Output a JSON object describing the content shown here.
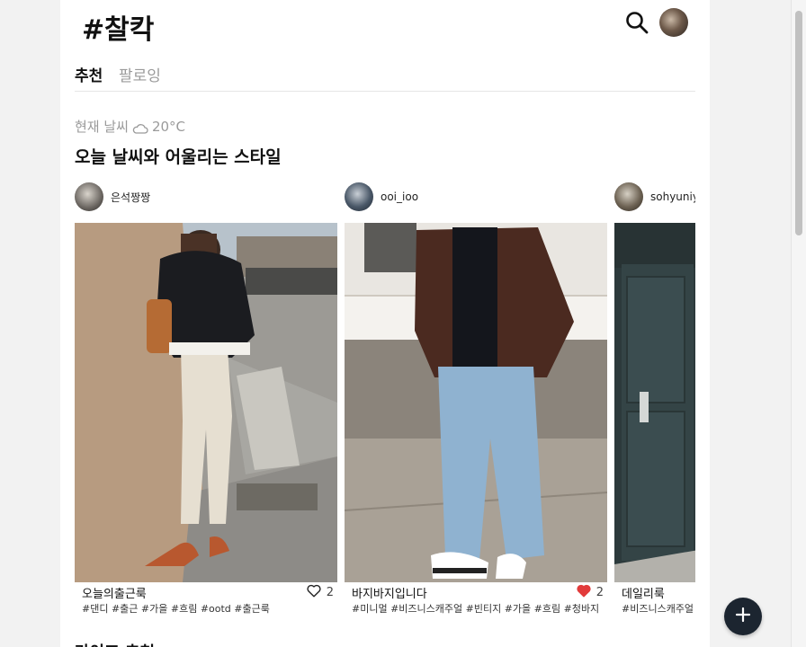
{
  "header": {
    "logo": "#찰칵",
    "search_icon": "search-icon",
    "avatar_icon": "profile-avatar"
  },
  "tabs": [
    {
      "label": "추천",
      "active": true
    },
    {
      "label": "팔로잉",
      "active": false
    }
  ],
  "weather": {
    "label": "현재 날씨",
    "icon": "cloud-icon",
    "temperature": "20°C"
  },
  "section_title": "오늘 날씨와 어울리는 스타일",
  "posts": [
    {
      "username": "은석짱짱",
      "caption": "오늘의출근룩",
      "likes": "2",
      "liked": false,
      "tags": "#댄디 #출근 #가을 #흐림 #ootd #출근룩"
    },
    {
      "username": "ooi_ioo",
      "caption": "바지바지입니다",
      "likes": "2",
      "liked": true,
      "tags": "#미니멀 #비즈니스캐주얼 #빈티지 #가을 #흐림 #청바지"
    },
    {
      "username": "sohyuniy",
      "caption": "데일리룩",
      "likes": "",
      "liked": false,
      "tags": "#비즈니스캐주얼"
    }
  ],
  "next_section_title": "라이프 추천",
  "fab": {
    "icon": "plus-icon"
  },
  "colors": {
    "accent": "#1c2530",
    "heart_liked": "#e23b3b",
    "muted_text": "#9a9a9a"
  }
}
